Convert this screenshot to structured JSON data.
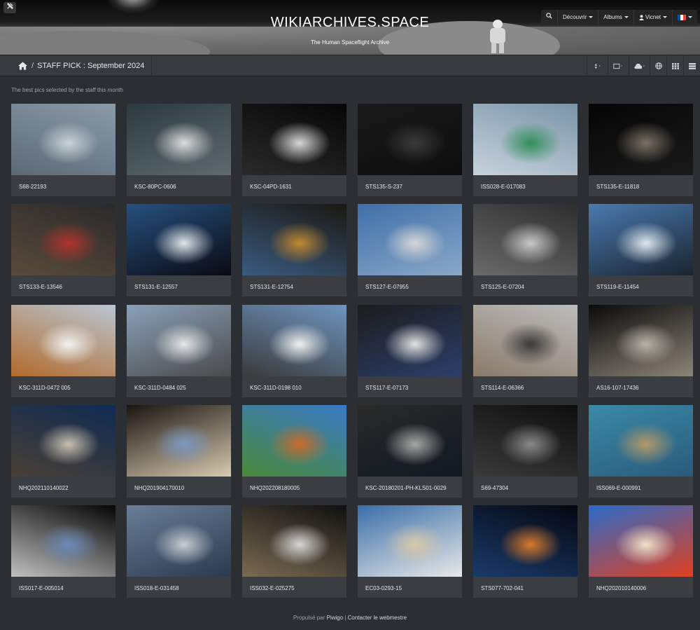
{
  "header": {
    "title": "WIKIARCHIVES.SPACE",
    "subtitle": "The Human Spaceflight Archive",
    "tools_icon": "tools-icon",
    "nav": {
      "search_icon": "search-icon",
      "discover": "Découvrir",
      "albums": "Albums",
      "user_icon": "user-icon",
      "user": "Vicnet",
      "language_flag": "fr-flag-icon"
    }
  },
  "toolbar": {
    "home_icon": "home-icon",
    "separator": "/",
    "breadcrumb": "STAFF PICK : September 2024",
    "buttons": [
      "sort-icon",
      "image-size-icon",
      "download-icon",
      "globe-icon",
      "grid-icon",
      "list-icon"
    ]
  },
  "description": "The best pics selected by the staff this month",
  "photos": [
    {
      "caption": "S68-22193",
      "colors": [
        "#8a9aa8",
        "#c9d2d8",
        "#5b6a75"
      ]
    },
    {
      "caption": "KSC-80PC-0606",
      "colors": [
        "#2c3a3e",
        "#dcdcdc",
        "#5e6a6e"
      ]
    },
    {
      "caption": "KSC-04PD-1631",
      "colors": [
        "#060606",
        "#d8d8d8",
        "#2a2a2a"
      ]
    },
    {
      "caption": "STS135-S-237",
      "colors": [
        "#1a1a1a",
        "#3a3a3a",
        "#0d0d0d"
      ]
    },
    {
      "caption": "ISS028-E-017083",
      "colors": [
        "#7a94a8",
        "#2f8f5a",
        "#c7d3dc"
      ]
    },
    {
      "caption": "STS135-E-11818",
      "colors": [
        "#050505",
        "#7a7064",
        "#1a1a1a"
      ]
    },
    {
      "caption": "STS133-E-13546",
      "colors": [
        "#2a2a2c",
        "#b0332c",
        "#5a4a3a"
      ]
    },
    {
      "caption": "STS131-E-12557",
      "colors": [
        "#26507e",
        "#e0e6ea",
        "#0a0a12"
      ]
    },
    {
      "caption": "STS131-E-12754",
      "colors": [
        "#1b1812",
        "#c0882e",
        "#3a5a80"
      ]
    },
    {
      "caption": "STS127-E-07955",
      "colors": [
        "#3f6fa8",
        "#d6d6d6",
        "#8aa8c8"
      ]
    },
    {
      "caption": "STS125-E-07204",
      "colors": [
        "#2e2e2e",
        "#c8c8c8",
        "#6a6a6a"
      ]
    },
    {
      "caption": "STS119-E-11454",
      "colors": [
        "#4a7ab0",
        "#dfe7ee",
        "#1a2430"
      ]
    },
    {
      "caption": "KSC-311D-0472 005",
      "colors": [
        "#b9c6d2",
        "#f2f2f2",
        "#b26a2c"
      ]
    },
    {
      "caption": "KSC-311D-0484 025",
      "colors": [
        "#8aa0b8",
        "#e6e6e6",
        "#4a4a4a"
      ]
    },
    {
      "caption": "KSC-311D-0198 010",
      "colors": [
        "#6e94c0",
        "#f0f0f0",
        "#3a3a3a"
      ]
    },
    {
      "caption": "STS117-E-07173",
      "colors": [
        "#1c1c1c",
        "#e2e2e2",
        "#2c3e6a"
      ]
    },
    {
      "caption": "STS114-E-06366",
      "colors": [
        "#bdbdbd",
        "#3a3a3a",
        "#8a7a6a"
      ]
    },
    {
      "caption": "AS16-107-17436",
      "colors": [
        "#0a0a0a",
        "#b8b2a8",
        "#8c8478"
      ]
    },
    {
      "caption": "NHQ202110140022",
      "colors": [
        "#0e2a52",
        "#c8c0b0",
        "#4a4036"
      ]
    },
    {
      "caption": "NHQ201904170010",
      "colors": [
        "#1a1410",
        "#7a98c0",
        "#d8cab0"
      ]
    },
    {
      "caption": "NHQ202208180005",
      "colors": [
        "#3a7ac8",
        "#c86a2a",
        "#4a8a3a"
      ]
    },
    {
      "caption": "KSC-20180201-PH-KLS01-0029",
      "colors": [
        "#2a2a2a",
        "#a8a8a8",
        "#101820"
      ]
    },
    {
      "caption": "S69-47304",
      "colors": [
        "#0e0e0e",
        "#8a8a8a",
        "#3a3a3a"
      ]
    },
    {
      "caption": "ISS069-E-000991",
      "colors": [
        "#3a8aa8",
        "#b49868",
        "#2a5a7a"
      ]
    },
    {
      "caption": "ISS017-E-005014",
      "colors": [
        "#040404",
        "#6a8ab8",
        "#c0c0c0"
      ]
    },
    {
      "caption": "ISS018-E-031458",
      "colors": [
        "#6a7e98",
        "#c6ccd2",
        "#2a3a4e"
      ]
    },
    {
      "caption": "ISS032-E-025275",
      "colors": [
        "#101010",
        "#d8d8d8",
        "#7a6a52"
      ]
    },
    {
      "caption": "EC03-0293-15",
      "colors": [
        "#3a6ea8",
        "#d8c8a8",
        "#e8e8e8"
      ]
    },
    {
      "caption": "STS077-702-041",
      "colors": [
        "#050710",
        "#d87a2a",
        "#1a3a6a"
      ]
    },
    {
      "caption": "NHQ202010140006",
      "colors": [
        "#2a6ac8",
        "#f0e0c8",
        "#e04020"
      ]
    }
  ],
  "footer": {
    "prefix": "Propulsé par",
    "piwigo": "Piwigo",
    "separator": "|",
    "contact": "Contacter le webmestre"
  }
}
